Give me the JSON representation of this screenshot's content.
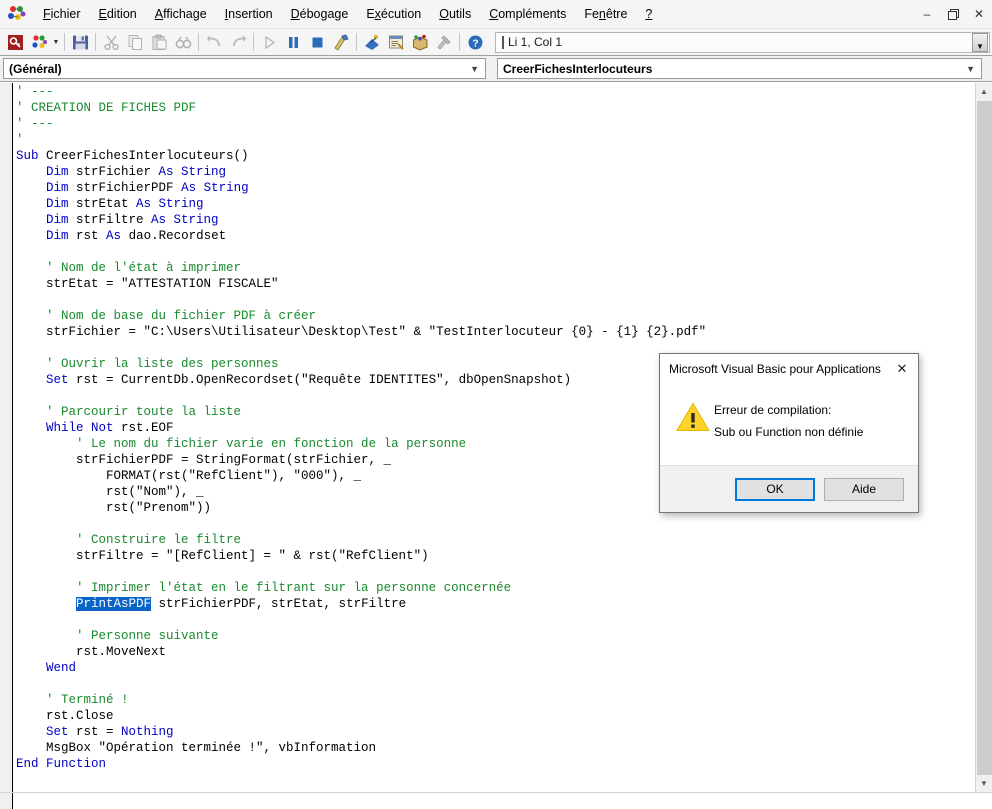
{
  "menu": {
    "logo_icon": "vba-logo-icon",
    "items": [
      {
        "label": "Fichier",
        "accel": "F",
        "name": "menu-fichier"
      },
      {
        "label": "Edition",
        "accel": "E",
        "name": "menu-edition"
      },
      {
        "label": "Affichage",
        "accel": "A",
        "name": "menu-affichage"
      },
      {
        "label": "Insertion",
        "accel": "I",
        "name": "menu-insertion"
      },
      {
        "label": "Débogage",
        "accel": "D",
        "name": "menu-debogage"
      },
      {
        "label": "Exécution",
        "accel": "x",
        "name": "menu-execution"
      },
      {
        "label": "Outils",
        "accel": "O",
        "name": "menu-outils"
      },
      {
        "label": "Compléments",
        "accel": "C",
        "name": "menu-complements"
      },
      {
        "label": "Fenêtre",
        "accel": "n",
        "name": "menu-fenetre"
      },
      {
        "label": "?",
        "accel": "?",
        "name": "menu-aide"
      }
    ],
    "window_controls": {
      "minimize": "–",
      "restore": "❐",
      "close": "✕"
    }
  },
  "toolbar": {
    "buttons": [
      {
        "name": "view-access-button",
        "icon": "access-key-icon"
      },
      {
        "name": "insert-object-button",
        "icon": "insert-object-icon"
      },
      {
        "name": "save-button",
        "icon": "save-disk-icon"
      },
      {
        "name": "cut-button",
        "icon": "scissors-icon"
      },
      {
        "name": "copy-button",
        "icon": "copy-icon"
      },
      {
        "name": "paste-button",
        "icon": "paste-icon"
      },
      {
        "name": "find-button",
        "icon": "binoculars-icon"
      },
      {
        "name": "undo-button",
        "icon": "undo-arrow-icon"
      },
      {
        "name": "redo-button",
        "icon": "redo-arrow-icon"
      },
      {
        "name": "run-button",
        "icon": "play-triangle-icon"
      },
      {
        "name": "break-button",
        "icon": "pause-bars-icon"
      },
      {
        "name": "reset-button",
        "icon": "stop-square-icon"
      },
      {
        "name": "design-mode-button",
        "icon": "ruler-pencil-icon"
      },
      {
        "name": "project-explorer-button",
        "icon": "project-explorer-icon"
      },
      {
        "name": "properties-window-button",
        "icon": "properties-window-icon"
      },
      {
        "name": "object-browser-button",
        "icon": "object-browser-icon"
      },
      {
        "name": "toolbox-button",
        "icon": "toolbox-hammer-icon"
      },
      {
        "name": "help-button",
        "icon": "help-question-icon"
      }
    ],
    "position_indicator": "Li 1, Col 1",
    "spinner_icon": "spinner-down-icon"
  },
  "combos": {
    "object": {
      "value": "(Général)",
      "arrow_icon": "chevron-down-icon"
    },
    "procedure": {
      "value": "CreerFichesInterlocuteurs",
      "arrow_icon": "chevron-down-icon"
    }
  },
  "code": {
    "lines": [
      [
        {
          "t": "' ---",
          "c": "cm"
        }
      ],
      [
        {
          "t": "' CREATION DE FICHES PDF",
          "c": "cm"
        }
      ],
      [
        {
          "t": "' ---",
          "c": "cm"
        }
      ],
      [
        {
          "t": "'",
          "c": "cm"
        }
      ],
      [
        {
          "t": "Sub ",
          "c": "kw"
        },
        {
          "t": "CreerFichesInterlocuteurs()",
          "c": ""
        }
      ],
      [
        {
          "t": "    ",
          "c": ""
        },
        {
          "t": "Dim ",
          "c": "kw"
        },
        {
          "t": "strFichier ",
          "c": ""
        },
        {
          "t": "As String",
          "c": "kw"
        }
      ],
      [
        {
          "t": "    ",
          "c": ""
        },
        {
          "t": "Dim ",
          "c": "kw"
        },
        {
          "t": "strFichierPDF ",
          "c": ""
        },
        {
          "t": "As String",
          "c": "kw"
        }
      ],
      [
        {
          "t": "    ",
          "c": ""
        },
        {
          "t": "Dim ",
          "c": "kw"
        },
        {
          "t": "strEtat ",
          "c": ""
        },
        {
          "t": "As String",
          "c": "kw"
        }
      ],
      [
        {
          "t": "    ",
          "c": ""
        },
        {
          "t": "Dim ",
          "c": "kw"
        },
        {
          "t": "strFiltre ",
          "c": ""
        },
        {
          "t": "As String",
          "c": "kw"
        }
      ],
      [
        {
          "t": "    ",
          "c": ""
        },
        {
          "t": "Dim ",
          "c": "kw"
        },
        {
          "t": "rst ",
          "c": ""
        },
        {
          "t": "As ",
          "c": "kw"
        },
        {
          "t": "dao.Recordset",
          "c": ""
        }
      ],
      [],
      [
        {
          "t": "    ",
          "c": ""
        },
        {
          "t": "' Nom de l'état à imprimer",
          "c": "cm"
        }
      ],
      [
        {
          "t": "    strEtat = \"ATTESTATION FISCALE\"",
          "c": ""
        }
      ],
      [],
      [
        {
          "t": "    ",
          "c": ""
        },
        {
          "t": "' Nom de base du fichier PDF à créer",
          "c": "cm"
        }
      ],
      [
        {
          "t": "    strFichier = \"C:\\Users\\Utilisateur\\Desktop\\Test\" & \"TestInterlocuteur {0} - {1} {2}.pdf\"",
          "c": ""
        }
      ],
      [],
      [
        {
          "t": "    ",
          "c": ""
        },
        {
          "t": "' Ouvrir la liste des personnes",
          "c": "cm"
        }
      ],
      [
        {
          "t": "    ",
          "c": ""
        },
        {
          "t": "Set ",
          "c": "kw"
        },
        {
          "t": "rst = CurrentDb.OpenRecordset(\"Requête IDENTITES\", dbOpenSnapshot)",
          "c": ""
        }
      ],
      [],
      [
        {
          "t": "    ",
          "c": ""
        },
        {
          "t": "' Parcourir toute la liste",
          "c": "cm"
        }
      ],
      [
        {
          "t": "    ",
          "c": ""
        },
        {
          "t": "While Not ",
          "c": "kw"
        },
        {
          "t": "rst.EOF",
          "c": ""
        }
      ],
      [
        {
          "t": "        ",
          "c": ""
        },
        {
          "t": "' Le nom du fichier varie en fonction de la personne",
          "c": "cm"
        }
      ],
      [
        {
          "t": "        strFichierPDF = StringFormat(strFichier, _",
          "c": ""
        }
      ],
      [
        {
          "t": "            FORMAT(rst(\"RefClient\"), \"000\"), _",
          "c": ""
        }
      ],
      [
        {
          "t": "            rst(\"Nom\"), _",
          "c": ""
        }
      ],
      [
        {
          "t": "            rst(\"Prenom\"))",
          "c": ""
        }
      ],
      [],
      [
        {
          "t": "        ",
          "c": ""
        },
        {
          "t": "' Construire le filtre",
          "c": "cm"
        }
      ],
      [
        {
          "t": "        strFiltre = \"[RefClient] = \" & rst(\"RefClient\")",
          "c": ""
        }
      ],
      [],
      [
        {
          "t": "        ",
          "c": ""
        },
        {
          "t": "' Imprimer l'état en le filtrant sur la personne concernée",
          "c": "cm"
        }
      ],
      [
        {
          "t": "        ",
          "c": ""
        },
        {
          "t": "PrintAsPDF",
          "c": "sel"
        },
        {
          "t": " strFichierPDF, strEtat, strFiltre",
          "c": ""
        }
      ],
      [],
      [
        {
          "t": "        ",
          "c": ""
        },
        {
          "t": "' Personne suivante",
          "c": "cm"
        }
      ],
      [
        {
          "t": "        rst.MoveNext",
          "c": ""
        }
      ],
      [
        {
          "t": "    ",
          "c": ""
        },
        {
          "t": "Wend",
          "c": "kw"
        }
      ],
      [],
      [
        {
          "t": "    ",
          "c": ""
        },
        {
          "t": "' Terminé !",
          "c": "cm"
        }
      ],
      [
        {
          "t": "    rst.Close",
          "c": ""
        }
      ],
      [
        {
          "t": "    ",
          "c": ""
        },
        {
          "t": "Set ",
          "c": "kw"
        },
        {
          "t": "rst = ",
          "c": ""
        },
        {
          "t": "Nothing",
          "c": "kw"
        }
      ],
      [
        {
          "t": "    MsgBox \"Opération terminée !\", vbInformation",
          "c": ""
        }
      ],
      [
        {
          "t": "End Function",
          "c": "kw"
        }
      ]
    ],
    "selected_token": "PrintAsPDF"
  },
  "scrollbars": {
    "vertical": {
      "up_icon": "scroll-up-arrow-icon",
      "down_icon": "scroll-down-arrow-icon"
    }
  },
  "dialog": {
    "title": "Microsoft Visual Basic pour Applications",
    "close_icon": "close-icon",
    "icon": "warning-triangle-icon",
    "message_line1": "Erreur de compilation:",
    "message_line2": "Sub ou Function non définie",
    "buttons": [
      {
        "label": "OK",
        "name": "dialog-ok-button",
        "focused": true
      },
      {
        "label": "Aide",
        "name": "dialog-aide-button",
        "focused": false
      }
    ]
  },
  "colors": {
    "keyword": "#0000C0",
    "comment": "#1A8A2E",
    "selection_bg": "#0A64C8",
    "focus_border": "#0078D7",
    "warning_yellow": "#FFD42A"
  }
}
